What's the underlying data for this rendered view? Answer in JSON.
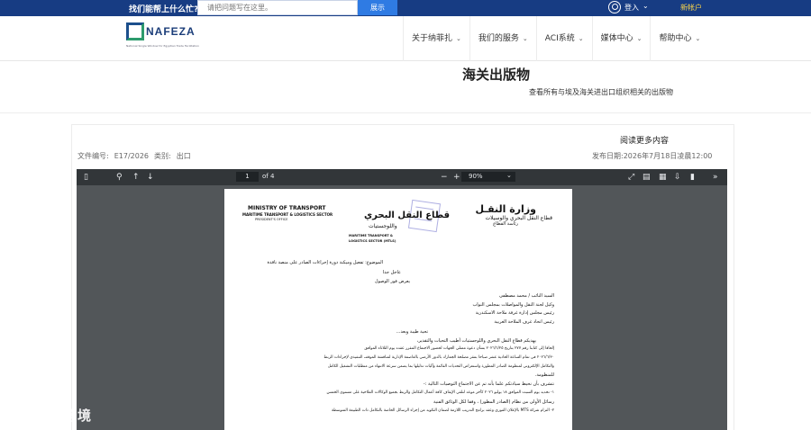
{
  "topbar": {
    "question": "找们能帮上什么忙?",
    "search_placeholder": "请把问题写在这里。",
    "search_button": "展示",
    "login": "登入",
    "login_chevron": "⌄",
    "new_account": "新帐户"
  },
  "nav": {
    "logo_name": "NAFEZA",
    "logo_tagline": "National Single Window for Egyptian Trade Facilitation",
    "items": [
      {
        "label": "关于纳菲扎"
      },
      {
        "label": "我们的服务"
      },
      {
        "label": "ACI系统"
      },
      {
        "label": "媒体中心"
      },
      {
        "label": "帮助中心"
      }
    ]
  },
  "page": {
    "title": "海关出版物",
    "subtitle": "查看所有与埃及海关进出口组织相关的出版物"
  },
  "document": {
    "more_content": "阅读更多内容",
    "file_number_label": "文件编号:",
    "file_number": "E17/2026",
    "category_label": "类别:",
    "category": "出口",
    "publish_label": "发布日期:",
    "publish_date": "2026年7月18日凌晨12:00"
  },
  "viewer": {
    "page_current": "1",
    "page_total": "of 4",
    "zoom": "90%",
    "minus": "−",
    "plus": "+"
  },
  "letter": {
    "en_title": "MINISTRY OF TRANSPORT",
    "en_sector": "MARITIME TRANSPORT & LOGISTICS SECTOR",
    "en_office": "PRESIDENT'S OFFICE",
    "ar_title": "وزارة النقـل",
    "ar_sector": "قطاع النقل البحري والوسيلات",
    "ar_office": "رئاسة القطاع",
    "center_ar": "قطاع النقل البحري",
    "center_ar2": "واللوجستيات",
    "center_en1": "MARITIME TRANSPORT &",
    "center_en2": "LOGISTICS SECTOR (MTLS)",
    "subject": "الموضوع: تفعيل وميكنة دورة إجراءات الصادر على منصة نافذة",
    "lines": [
      "عاجل جدا",
      "يعرض فور الوصول",
      "السيد النائب / محمد مصطفى",
      "وكيل لجنة النقل والمواصلات بمجلس النواب",
      "رئيس مجلس إدارة غرفة ملاحة الاسكندرية",
      "رئيس اتحاد غرف الملاحة العربية",
      "تحية طيبة وبعد...",
      "يهديكم قطاع النقل البحري واللوجستيات أطيب التحيات والتقدير،",
      "إلحاقا إلى كتابنا رقم ٢٧٧ بتاريخ ٢٠٢٦/٦/٢٥ بشأن دعوة ممثلي الجهات لحضور الاجتماع المقرر عقده يوم الثلاثاء الموافق",
      "٢٠٢٦/٦/٣٠ في تمام الساعة الحادية عشر صباحا بمقر مصلحة الجمارك بالدور الأرضي بالعاصمة الإدارية لمناقشة الموقف التنفيذي لإجراءات الربط",
      "والتكامل الإلكتروني لمنظومة الصادر المطورة واستعراض التحديات القائمة وآليات تذليلها بما يضمن سرعة الانتهاء من متطلبات التشغيل الكامل",
      "للمنظومة.",
      "نتشرف بأن نحيط سيادتكم علما بأنه تم عن الاجتماع التوصيات التالية :-",
      "١- تحديد يوم السبت الموافق ١٨ يوليو ٢٠٢٦ كآخر موعد لتلقي الإيقاف كافة أعمال التكامل والربط بجميع الوكالات الملاحية على مستوى الخمس",
      "رسائل الأولى من نظام (الصادر المطور) ، وفقا لكل الوثائق الفنية",
      "٢- التزام شركة MTS بالإعلان الفوري وعقد برامج التدريب اللازمة لضمان التكويد من إجراء الرسائل الخاصة بالتكامل ذات الطبيعة المتوسطة"
    ]
  }
}
